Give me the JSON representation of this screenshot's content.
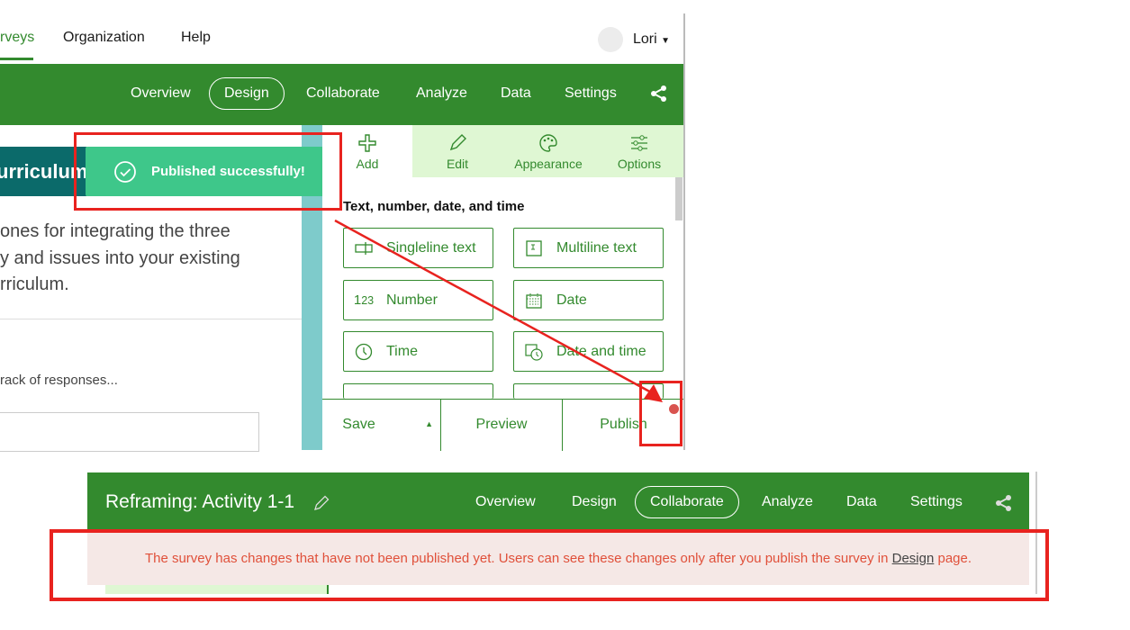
{
  "top_nav": {
    "items": [
      "rveys",
      "Organization",
      "Help"
    ],
    "user": "Lori"
  },
  "survey_nav": {
    "items": [
      "Overview",
      "Design",
      "Collaborate",
      "Analyze",
      "Data",
      "Settings"
    ],
    "active": "Design"
  },
  "left_panel": {
    "header": "urriculum",
    "text_lines": [
      "ones for integrating the three",
      "y and issues into your existing",
      "rriculum."
    ],
    "prompt": "rack of responses..."
  },
  "toast": {
    "message": "Published successfully!"
  },
  "designer": {
    "tabs": [
      {
        "label": "Add",
        "icon": "plus-icon"
      },
      {
        "label": "Edit",
        "icon": "pencil-icon"
      },
      {
        "label": "Appearance",
        "icon": "palette-icon"
      },
      {
        "label": "Options",
        "icon": "sliders-icon"
      }
    ],
    "section_title": "Text, number, date, and time",
    "fields": [
      {
        "label": "Singleline text",
        "icon": "singleline-icon"
      },
      {
        "label": "Multiline text",
        "icon": "multiline-icon"
      },
      {
        "label": "Number",
        "icon": "number-icon"
      },
      {
        "label": "Date",
        "icon": "calendar-icon"
      },
      {
        "label": "Time",
        "icon": "clock-icon"
      },
      {
        "label": "Date and time",
        "icon": "calendar-clock-icon"
      }
    ],
    "actions": {
      "save": "Save",
      "preview": "Preview",
      "publish": "Publish"
    }
  },
  "second": {
    "title": "Reframing: Activity 1-1",
    "nav": {
      "items": [
        "Overview",
        "Design",
        "Collaborate",
        "Analyze",
        "Data",
        "Settings"
      ],
      "active": "Collaborate"
    },
    "warning": {
      "before": "The survey has changes that have not been published yet. Users can see these changes only after you publish the survey in ",
      "link": "Design",
      "after": " page."
    }
  },
  "colors": {
    "brand_green": "#338a2e",
    "toast": "#3ec78a",
    "annotation_red": "#e8231f",
    "warning_text": "#e0503a",
    "warning_bg": "#f5e8e6"
  }
}
